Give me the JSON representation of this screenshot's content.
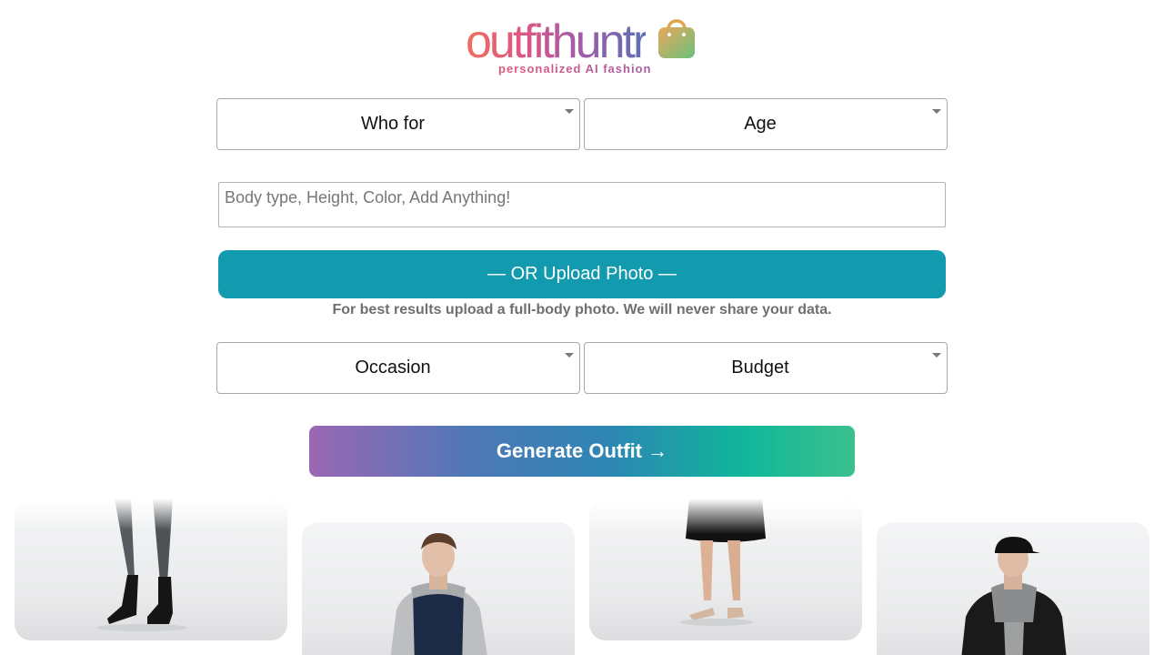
{
  "brand": {
    "logo_text": "outfithuntr",
    "tagline": "personalized AI fashion"
  },
  "form": {
    "who_for": "Who for",
    "age": "Age",
    "details_placeholder": "Body type, Height, Color, Add Anything!",
    "upload_label": "— OR Upload Photo —",
    "upload_note": "For best results upload a full-body photo. We will never share your data.",
    "occasion": "Occasion",
    "budget": "Budget",
    "generate_label": "Generate Outfit →"
  },
  "gallery": {
    "items": [
      {
        "icon": "boots-legs-photo"
      },
      {
        "icon": "grey-hoodie-man-photo"
      },
      {
        "icon": "black-skirt-sandals-photo"
      },
      {
        "icon": "black-jacket-cap-man-photo"
      }
    ]
  },
  "colors": {
    "upload_button": "#129aae",
    "tagline": "#c05a8e"
  }
}
